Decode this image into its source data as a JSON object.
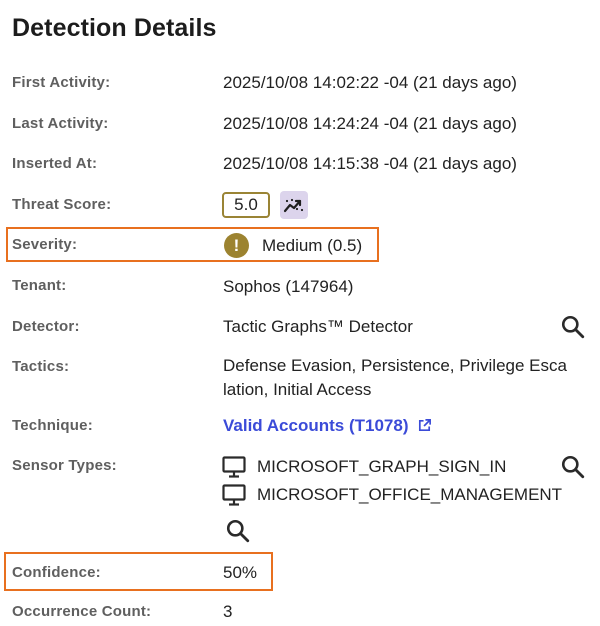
{
  "page": {
    "title": "Detection Details"
  },
  "fields": {
    "first_activity": {
      "label": "First Activity:",
      "value": "2025/10/08 14:02:22 -04 (21 days ago)"
    },
    "last_activity": {
      "label": "Last Activity:",
      "value": "2025/10/08 14:24:24 -04 (21 days ago)"
    },
    "inserted_at": {
      "label": "Inserted At:",
      "value": "2025/10/08 14:15:38 -04 (21 days ago)"
    },
    "threat_score": {
      "label": "Threat Score:",
      "value": "5.0"
    },
    "severity": {
      "label": "Severity:",
      "value": "Medium (0.5)",
      "icon_glyph": "!"
    },
    "tenant": {
      "label": "Tenant:",
      "value": "Sophos (147964)"
    },
    "detector": {
      "label": "Detector:",
      "value": "Tactic Graphs™ Detector"
    },
    "tactics": {
      "label": "Tactics:",
      "line1": "Defense Evasion, Persistence, Privilege Esca",
      "line2": "lation, Initial Access"
    },
    "technique": {
      "label": "Technique:",
      "value": "Valid Accounts (T1078)"
    },
    "sensor_types": {
      "label": "Sensor Types:",
      "items": [
        "MICROSOFT_GRAPH_SIGN_IN",
        "MICROSOFT_OFFICE_MANAGEMENT"
      ]
    },
    "confidence": {
      "label": "Confidence:",
      "value": "50%"
    },
    "occurrence_count": {
      "label": "Occurrence Count:",
      "value": "3"
    }
  },
  "colors": {
    "highlight": "#e8701f",
    "severity_medium": "#9c8330",
    "link": "#3b4bd8",
    "trend_button_bg": "#dcd4ec"
  },
  "icons": [
    "trend-chart-icon",
    "warning-icon",
    "search-icon",
    "monitor-icon",
    "external-link-icon"
  ]
}
